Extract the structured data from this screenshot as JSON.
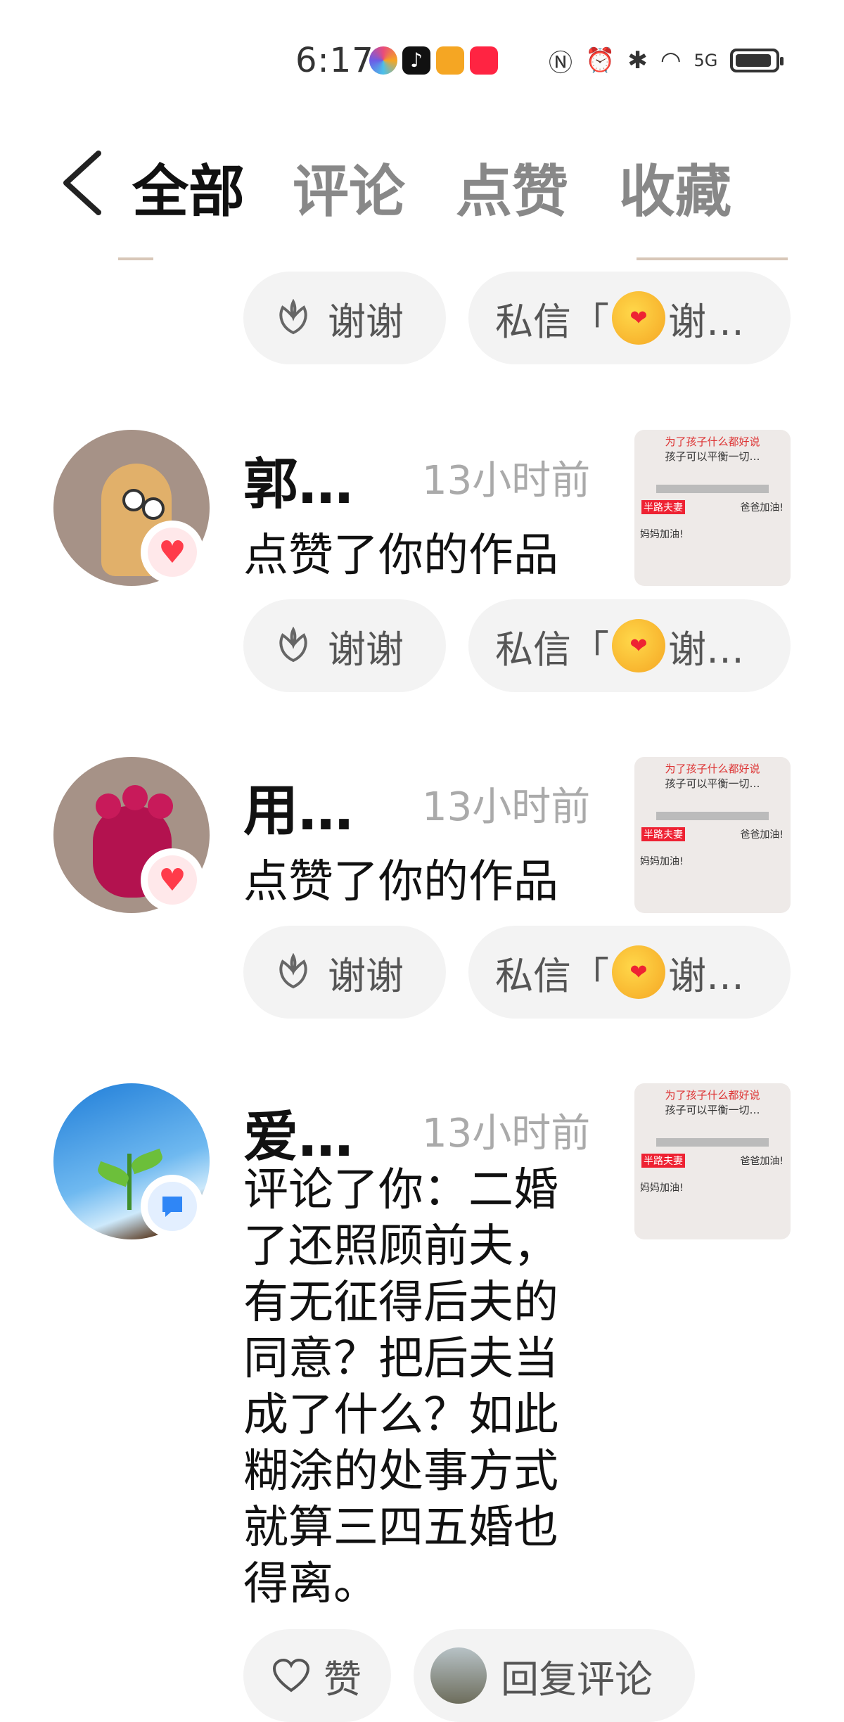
{
  "status": {
    "time": "6:17",
    "signal": "5G"
  },
  "tabs": [
    {
      "label": "全部"
    },
    {
      "label": "评论"
    },
    {
      "label": "点赞"
    },
    {
      "label": "收藏"
    }
  ],
  "buttons": {
    "thanks": "谢谢",
    "dm_prefix": "私信「",
    "dm_suffix": "谢…",
    "like": "赞",
    "reply": "回复评论"
  },
  "notifications": [
    {
      "name": "郭…",
      "time": "13小时前",
      "action": "点赞了你的作品"
    },
    {
      "name": "用…",
      "time": "13小时前",
      "action": "点赞了你的作品"
    },
    {
      "name": "爱…",
      "time": "13小时前",
      "action": "评论了你：二婚了还照顾前夫，有无征得后夫的同意？把后夫当成了什么？如此糊涂的处事方式就算三四五婚也得离。"
    }
  ],
  "thumbnail": {
    "line1": "为了孩子什么都好说",
    "line2": "孩子可以平衡一切…",
    "label1": "半路夫妻",
    "label2": "爸爸加油!",
    "label3": "妈妈加油!"
  },
  "colors": {
    "like_badge": "#ff3b4a",
    "comment_badge": "#2f86f6",
    "tab_active": "#111111",
    "tab_inactive": "#888888"
  }
}
